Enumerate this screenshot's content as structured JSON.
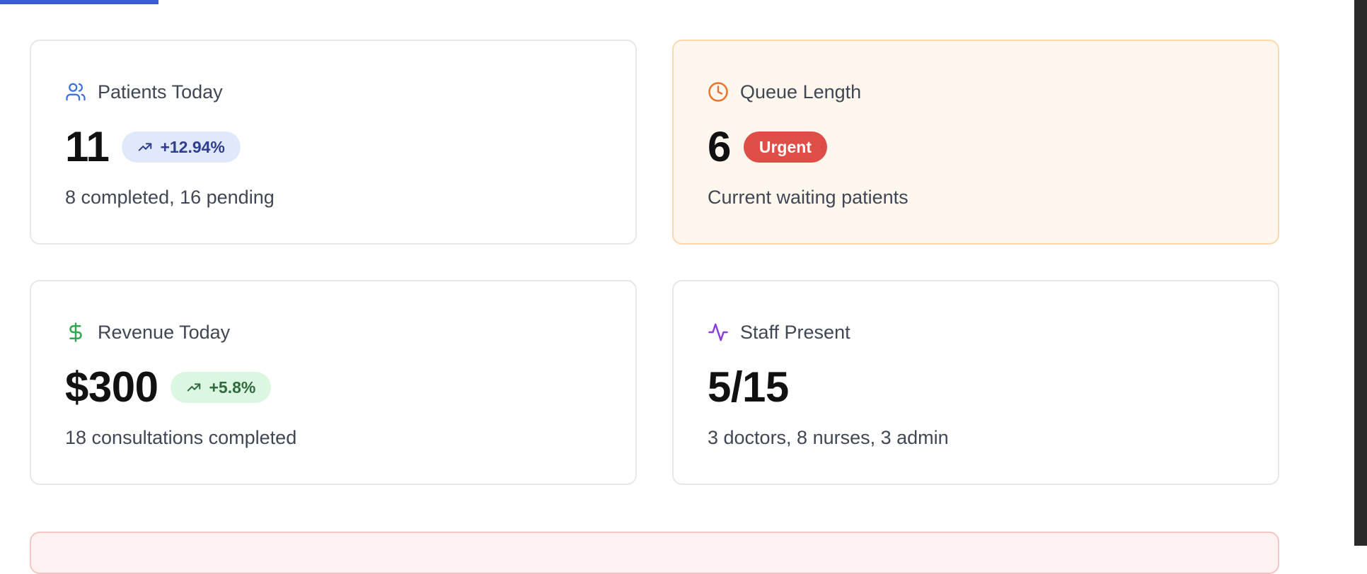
{
  "cards": [
    {
      "title": "Patients Today",
      "icon": "users-icon",
      "value": "11",
      "badge": "+12.94%",
      "badge_icon": "trending-up-icon",
      "subtext": "8 completed, 16 pending"
    },
    {
      "title": "Queue Length",
      "icon": "clock-icon",
      "value": "6",
      "badge": "Urgent",
      "subtext": "Current waiting patients"
    },
    {
      "title": "Revenue Today",
      "icon": "dollar-icon",
      "value": "$300",
      "badge": "+5.8%",
      "badge_icon": "trending-up-icon",
      "subtext": "18 consultations completed"
    },
    {
      "title": "Staff Present",
      "icon": "activity-icon",
      "value": "5/15",
      "subtext": "3 doctors, 8 nurses, 3 admin"
    }
  ],
  "colors": {
    "accent_blue": "#3b5bdb",
    "icon_blue": "#3b6fe0",
    "icon_orange": "#e8742c",
    "icon_green": "#2fa84f",
    "icon_purple": "#8b3fe0",
    "urgent_red": "#df4d47",
    "warning_bg": "#fff6ed",
    "alert_bg": "#fdf2f2"
  }
}
